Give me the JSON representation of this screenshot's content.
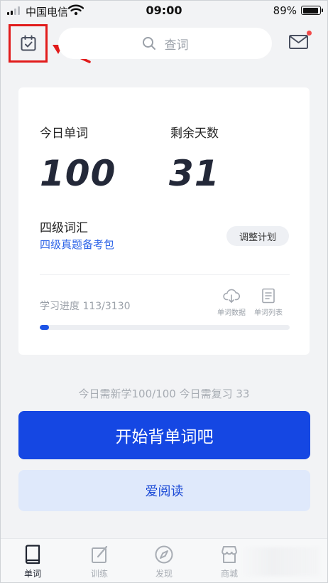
{
  "status_bar": {
    "carrier": "中国电信",
    "time": "09:00",
    "battery": "89%"
  },
  "header": {
    "search_placeholder": "查词",
    "icons": [
      "calendar-check-icon",
      "search-icon",
      "mail-icon"
    ]
  },
  "card": {
    "today_words_label": "今日单词",
    "today_words_value": "100",
    "days_left_label": "剩余天数",
    "days_left_value": "31",
    "book_title": "四级词汇",
    "book_subtitle": "四级真题备考包",
    "adjust_button": "调整计划",
    "progress_text": "学习进度 113/3130",
    "progress_fraction": 0.036,
    "tools": [
      {
        "label": "单词数据",
        "icon": "cloud-download-icon"
      },
      {
        "label": "单词列表",
        "icon": "document-list-icon"
      }
    ]
  },
  "today_summary": "今日需新学100/100  今日需复习 33",
  "start_button": "开始背单词吧",
  "read_button": "爱阅读",
  "tabs": [
    {
      "label": "单词",
      "icon": "book-icon",
      "active": true
    },
    {
      "label": "训练",
      "icon": "edit-icon",
      "active": false
    },
    {
      "label": "发现",
      "icon": "compass-icon",
      "active": false
    },
    {
      "label": "商城",
      "icon": "store-icon",
      "active": false
    }
  ],
  "colors": {
    "accent": "#1547e3",
    "link": "#2f66e8",
    "highlight_box": "#e11b1b",
    "background": "#f2f3f5"
  }
}
